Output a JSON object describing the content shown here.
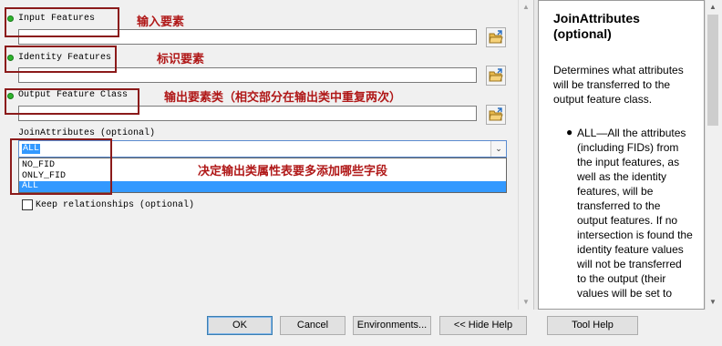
{
  "params": {
    "input_features": {
      "label": "Input Features",
      "value": ""
    },
    "identity_features": {
      "label": "Identity Features",
      "value": ""
    },
    "output_feature_class": {
      "label": "Output Feature Class",
      "value": ""
    },
    "join_attributes": {
      "label": "JoinAttributes (optional)",
      "selected": "ALL",
      "options": [
        "NO_FID",
        "ONLY_FID",
        "ALL"
      ]
    },
    "keep_relationships": {
      "label": "Keep relationships (optional)",
      "checked": false
    }
  },
  "annotations": {
    "input": "输入要素",
    "identity": "标识要素",
    "output": "输出要素类（相交部分在输出类中重复两次）",
    "join": "决定输出类属性表要多添加哪些字段"
  },
  "help": {
    "title": "JoinAttributes (optional)",
    "description": "Determines what attributes will be transferred to the output feature class.",
    "bullet_text": "ALL—All the attributes (including FIDs) from the input features, as well as the identity features, will be transferred to the output features. If no intersection is found the identity feature values will not be transferred to the output (their values will be set to"
  },
  "buttons": {
    "ok": "OK",
    "cancel": "Cancel",
    "environments": "Environments...",
    "hide_help": "<< Hide Help",
    "tool_help": "Tool Help"
  },
  "colors": {
    "annotation_red": "#b01818",
    "required_dot": "#2db52d",
    "selection_blue": "#3399ff"
  },
  "icons": {
    "browse": "open-folder-icon",
    "required": "green-dot-icon",
    "dropdown": "chevron-down-icon"
  }
}
